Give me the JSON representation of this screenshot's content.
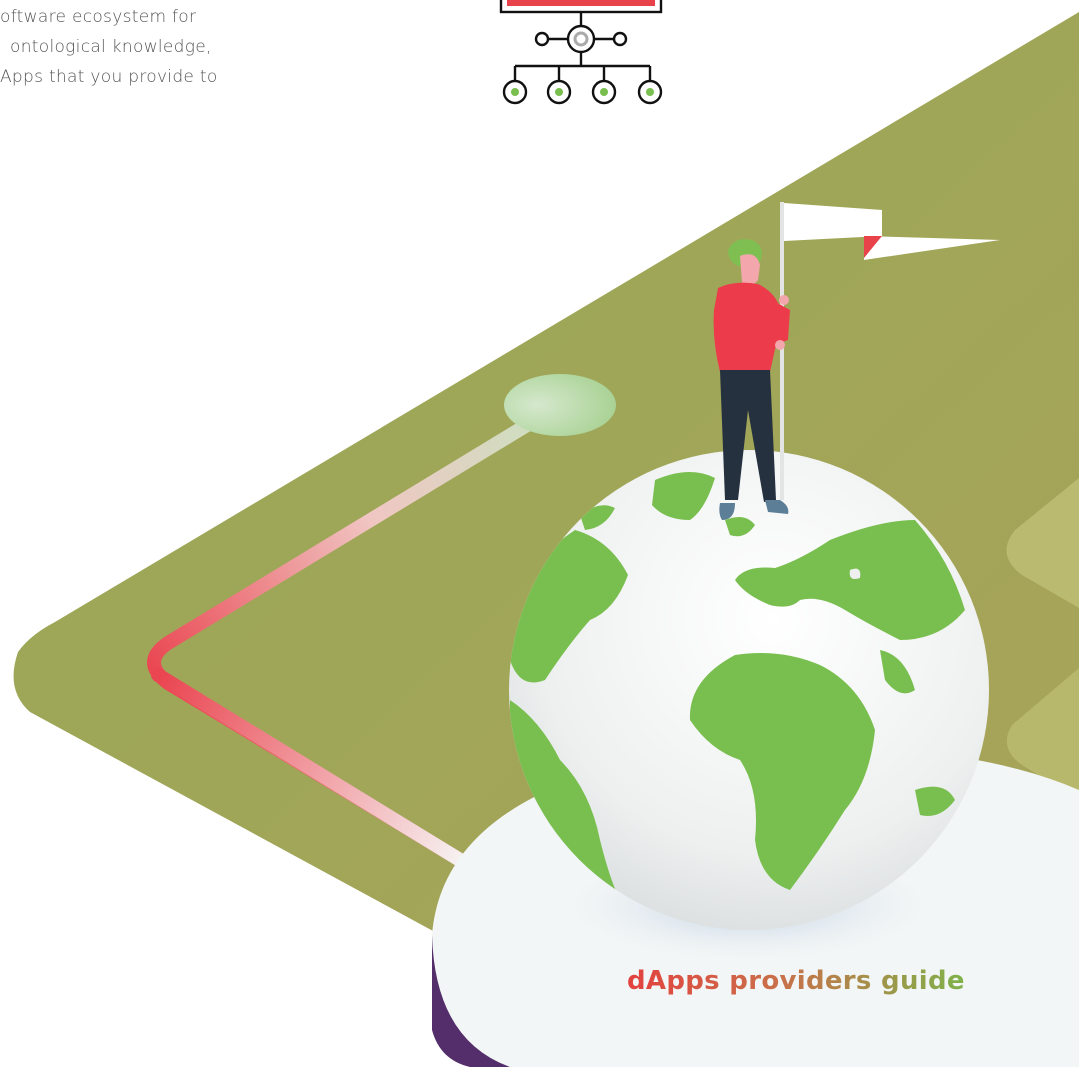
{
  "intro_text": {
    "lines": [
      "oftware ecosystem for",
      "ontological knowledge,",
      "Apps that you provide to"
    ]
  },
  "guide": {
    "title": "dApps providers guide"
  },
  "colors": {
    "olive_background": "#a1a955",
    "card_surface": "#f3f6f6",
    "card_edge": "#532e6a",
    "globe_land": "#79bf4f",
    "accent_red": "#e8434b",
    "figure_shirt": "#ec3c4c",
    "figure_pants": "#263140",
    "hair": "#7fbf52",
    "title_gradient_start": "#e3423f",
    "title_gradient_end": "#7fb24a"
  },
  "icons": {
    "hierarchy": "network-hierarchy-icon",
    "flag": "flag-icon",
    "globe": "globe-illustration",
    "person": "person-with-flag-illustration"
  }
}
